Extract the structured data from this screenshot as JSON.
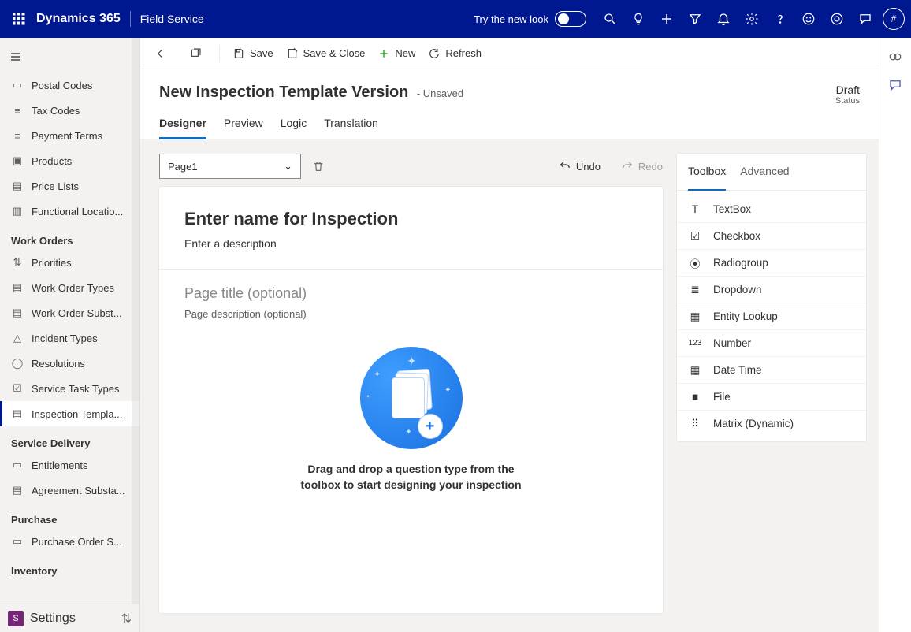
{
  "topbar": {
    "brand": "Dynamics 365",
    "app": "Field Service",
    "try_label": "Try the new look",
    "avatar_initial": "#"
  },
  "sidebar": {
    "items_top": [
      {
        "label": "Postal Codes"
      },
      {
        "label": "Tax Codes"
      },
      {
        "label": "Payment Terms"
      },
      {
        "label": "Products"
      },
      {
        "label": "Price Lists"
      },
      {
        "label": "Functional Locatio..."
      }
    ],
    "group_workorders": "Work Orders",
    "items_wo": [
      {
        "label": "Priorities"
      },
      {
        "label": "Work Order Types"
      },
      {
        "label": "Work Order Subst..."
      },
      {
        "label": "Incident Types"
      },
      {
        "label": "Resolutions"
      },
      {
        "label": "Service Task Types"
      },
      {
        "label": "Inspection Templa..."
      }
    ],
    "group_sd": "Service Delivery",
    "items_sd": [
      {
        "label": "Entitlements"
      },
      {
        "label": "Agreement Substa..."
      }
    ],
    "group_purchase": "Purchase",
    "items_pr": [
      {
        "label": "Purchase Order S..."
      }
    ],
    "group_inventory": "Inventory",
    "bottom": {
      "label": "Settings",
      "badge": "S"
    }
  },
  "cmdbar": {
    "save": "Save",
    "save_close": "Save & Close",
    "new": "New",
    "refresh": "Refresh"
  },
  "header": {
    "title": "New Inspection Template Version",
    "unsaved": "- Unsaved",
    "status_value": "Draft",
    "status_label": "Status"
  },
  "tabs": [
    {
      "label": "Designer",
      "active": true
    },
    {
      "label": "Preview"
    },
    {
      "label": "Logic"
    },
    {
      "label": "Translation"
    }
  ],
  "designer": {
    "page_select": "Page1",
    "undo": "Undo",
    "redo": "Redo",
    "inspection_title": "Enter name for Inspection",
    "inspection_desc": "Enter a description",
    "page_title": "Page title (optional)",
    "page_desc": "Page description (optional)",
    "drop_text": "Drag and drop a question type from the toolbox to start designing your inspection"
  },
  "toolbox": {
    "tabs": [
      {
        "label": "Toolbox",
        "active": true
      },
      {
        "label": "Advanced"
      }
    ],
    "items": [
      {
        "label": "TextBox"
      },
      {
        "label": "Checkbox"
      },
      {
        "label": "Radiogroup"
      },
      {
        "label": "Dropdown"
      },
      {
        "label": "Entity Lookup"
      },
      {
        "label": "Number"
      },
      {
        "label": "Date Time"
      },
      {
        "label": "File"
      },
      {
        "label": "Matrix (Dynamic)"
      }
    ]
  }
}
